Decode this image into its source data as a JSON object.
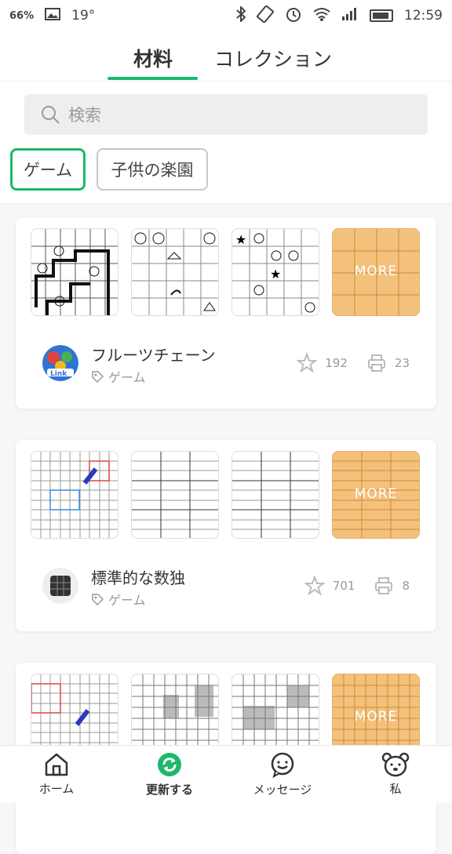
{
  "status_bar": {
    "battery_pct": "66%",
    "temperature": "19°",
    "time": "12:59"
  },
  "tabs": [
    {
      "label": "材料",
      "active": true
    },
    {
      "label": "コレクション",
      "active": false
    }
  ],
  "search": {
    "placeholder": "検索"
  },
  "filters": [
    {
      "label": "ゲーム",
      "active": true
    },
    {
      "label": "子供の楽園",
      "active": false
    }
  ],
  "more_label": "MORE",
  "cards": [
    {
      "title": "フルーツチェーン",
      "tag": "ゲーム",
      "stars": "192",
      "prints": "23"
    },
    {
      "title": "標準的な数独",
      "tag": "ゲーム",
      "stars": "701",
      "prints": "8"
    },
    {
      "title": "",
      "tag": "",
      "stars": "",
      "prints": ""
    }
  ],
  "bottom_nav": [
    {
      "label": "ホーム",
      "icon": "home-icon"
    },
    {
      "label": "更新する",
      "icon": "refresh-icon",
      "active": true
    },
    {
      "label": "メッセージ",
      "icon": "message-icon"
    },
    {
      "label": "私",
      "icon": "bear-icon"
    }
  ],
  "colors": {
    "accent": "#1cb86b",
    "more_bg": "#f4c17c"
  }
}
